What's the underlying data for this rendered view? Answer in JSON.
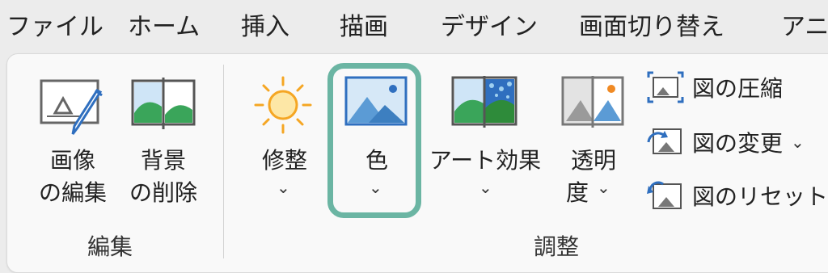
{
  "tabs": [
    "ファイル",
    "ホーム",
    "挿入",
    "描画",
    "デザイン",
    "画面切り替え",
    "アニ"
  ],
  "edit_group": {
    "label": "編集",
    "image_edit": [
      "画像",
      "の編集"
    ],
    "remove_bg": [
      "背景",
      "の削除"
    ]
  },
  "adjust_group": {
    "label": "調整",
    "corrections": "修整",
    "color": "色",
    "artistic": "アート効果",
    "transparency": [
      "透明",
      "度"
    ]
  },
  "small_buttons": {
    "compress": "図の圧縮",
    "change": "図の変更",
    "reset": "図のリセット"
  },
  "chevron": "⌄",
  "colors": {
    "accent_outline": "#6bb5a3",
    "icon_blue": "#5b9bd5",
    "icon_green": "#3aa55a",
    "sun": "#f5a623"
  }
}
